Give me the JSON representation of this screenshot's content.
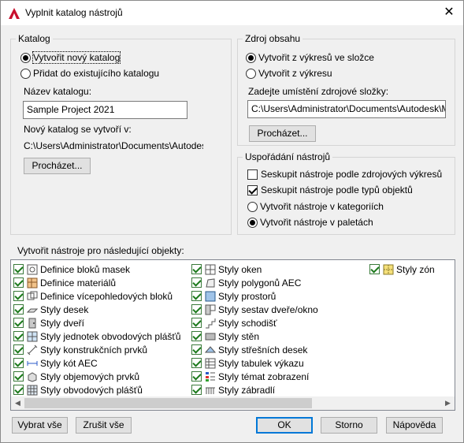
{
  "window": {
    "title": "Vyplnit katalog nástrojů",
    "close_glyph": "✕"
  },
  "catalog": {
    "legend": "Katalog",
    "create_new": "Vytvořit nový katalog",
    "add_existing": "Přidat do existujícího katalogu",
    "name_label": "Název katalogu:",
    "name_value": "Sample Project 2021",
    "created_in_label": "Nový katalog se vytvoří v:",
    "created_in_path": "C:\\Users\\Administrator\\Documents\\Autodesk\\M",
    "browse": "Procházet..."
  },
  "source": {
    "legend": "Zdroj obsahu",
    "from_drawings_folder": "Vytvořit z výkresů ve složce",
    "from_drawing": "Vytvořit z výkresu",
    "folder_label": "Zadejte umístění zdrojové složky:",
    "folder_value": "C:\\Users\\Administrator\\Documents\\Autodesk\\Moje",
    "browse": "Procházet..."
  },
  "arrangement": {
    "legend": "Uspořádání nástrojů",
    "group_by_source": "Seskupit nástroje podle zdrojových výkresů",
    "group_by_type": "Seskupit nástroje podle typů objektů",
    "in_categories": "Vytvořit nástroje v kategoriích",
    "in_palettes": "Vytvořit nástroje v paletách",
    "group_by_source_checked": false,
    "group_by_type_checked": true,
    "selected_target": "palettes"
  },
  "objects": {
    "label": "Vytvořit nástroje pro následující objekty:",
    "columns": [
      [
        {
          "label": "Definice bloků masek",
          "icon": "mask-block-icon"
        },
        {
          "label": "Definice materiálů",
          "icon": "material-icon"
        },
        {
          "label": "Definice vícepohledových bloků",
          "icon": "multiview-block-icon"
        },
        {
          "label": "Styly desek",
          "icon": "slab-icon"
        },
        {
          "label": "Styly dveří",
          "icon": "door-icon"
        },
        {
          "label": "Styly jednotek obvodových plášťů",
          "icon": "curtain-wall-unit-icon"
        },
        {
          "label": "Styly konstrukčních prvků",
          "icon": "structural-member-icon"
        },
        {
          "label": "Styly kót AEC",
          "icon": "aec-dimension-icon"
        },
        {
          "label": "Styly objemových prvků",
          "icon": "mass-element-icon"
        },
        {
          "label": "Styly obvodových plášťů",
          "icon": "curtain-wall-icon"
        }
      ],
      [
        {
          "label": "Styly oken",
          "icon": "window-icon"
        },
        {
          "label": "Styly polygonů AEC",
          "icon": "aec-polygon-icon"
        },
        {
          "label": "Styly prostorů",
          "icon": "space-icon"
        },
        {
          "label": "Styly sestav dveře/okno",
          "icon": "door-window-assembly-icon"
        },
        {
          "label": "Styly schodišť",
          "icon": "stair-icon"
        },
        {
          "label": "Styly stěn",
          "icon": "wall-icon"
        },
        {
          "label": "Styly střešních desek",
          "icon": "roof-slab-icon"
        },
        {
          "label": "Styly tabulek výkazu",
          "icon": "schedule-table-icon"
        },
        {
          "label": "Styly témat zobrazení",
          "icon": "display-theme-icon"
        },
        {
          "label": "Styly zábradlí",
          "icon": "railing-icon"
        }
      ],
      [
        {
          "label": "Styly zón",
          "icon": "zone-icon"
        }
      ]
    ]
  },
  "buttons": {
    "select_all": "Vybrat vše",
    "clear_all": "Zrušit vše",
    "ok": "OK",
    "cancel": "Storno",
    "help": "Nápověda"
  },
  "colors": {
    "accent": "#0078d7",
    "check": "#1c7a1c",
    "app_icon": "#c8102e"
  }
}
